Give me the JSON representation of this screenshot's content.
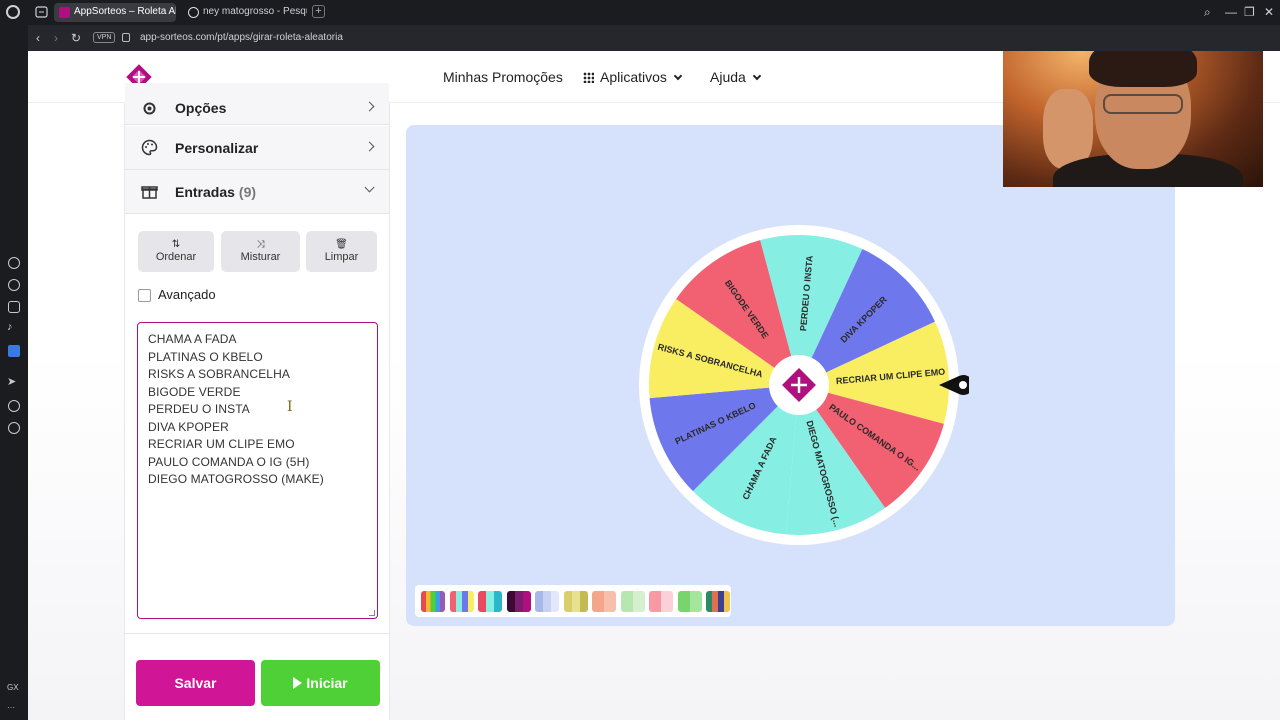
{
  "browser": {
    "tabs": [
      {
        "title": "AppSorteos – Roleta Aleat",
        "active": true
      },
      {
        "title": "ney matogrosso - Pesquis",
        "active": false
      }
    ],
    "url": "app-sorteos.com/pt/apps/girar-roleta-aleatoria",
    "vpn_label": "VPN",
    "sidebar_label": "GX"
  },
  "nav": {
    "promotions": "Minhas Promoções",
    "apps": "Aplicativos",
    "help": "Ajuda"
  },
  "panel": {
    "options_label": "Opções",
    "customize_label": "Personalizar",
    "entries_label": "Entradas",
    "entries_count": "(9)",
    "sort_label": "Ordenar",
    "shuffle_label": "Misturar",
    "clear_label": "Limpar",
    "advanced_label": "Avançado",
    "entries": [
      "CHAMA A FADA",
      "PLATINAS O KBELO",
      "RISKS A SOBRANCELHA",
      "BIGODE VERDE",
      "PERDEU O INSTA",
      "DIVA KPOPER",
      "RECRIAR UM CLIPE EMO",
      "PAULO COMANDA O IG (5H)",
      "DIEGO MATOGROSSO (MAKE)"
    ],
    "save_label": "Salvar",
    "start_label": "Iniciar"
  },
  "wheel": {
    "segments": [
      {
        "label": "RECRIAR UM CLIPE EMO",
        "color": "#f9ee62"
      },
      {
        "label": "PAULO COMANDA O IG...",
        "color": "#f26172"
      },
      {
        "label": "DIEGO MATOGROSSO (...",
        "color": "#87eee3"
      },
      {
        "label": "CHAMA A FADA",
        "color": "#87eee3"
      },
      {
        "label": "PLATINAS O KBELO",
        "color": "#6f77ec"
      },
      {
        "label": "RISKS A SOBRANCELHA",
        "color": "#f9ee62"
      },
      {
        "label": "BIGODE VERDE",
        "color": "#f26172"
      },
      {
        "label": "PERDEU O INSTA",
        "color": "#87eee3"
      },
      {
        "label": "DIVA KPOPER",
        "color": "#6f77ec"
      }
    ],
    "accent_color": "#b0107f"
  },
  "palette": {
    "swatches": [
      [
        "#e54b4b",
        "#f7b731",
        "#4cd137",
        "#3c9ee5",
        "#9b59b6"
      ],
      [
        "#f26172",
        "#87eee3",
        "#6f77ec",
        "#f9ee62"
      ],
      [
        "#e84a5f",
        "#87eee3",
        "#2ab7ca"
      ],
      [
        "#3d0a36",
        "#7c1c6e",
        "#b0107f"
      ],
      [
        "#a6b7ea",
        "#c8d3f3",
        "#e2e8fa"
      ],
      [
        "#d6cf6a",
        "#e8e18f",
        "#c2ba52"
      ],
      [
        "#f4a58a",
        "#f7c0ad"
      ],
      [
        "#b8e6b0",
        "#d4f0cf"
      ],
      [
        "#f79aa6",
        "#fbd0d6"
      ],
      [
        "#78d56e",
        "#a5e69e"
      ],
      [
        "#2b8a63",
        "#e36f52",
        "#3d3f8f",
        "#f0c14b"
      ]
    ]
  }
}
